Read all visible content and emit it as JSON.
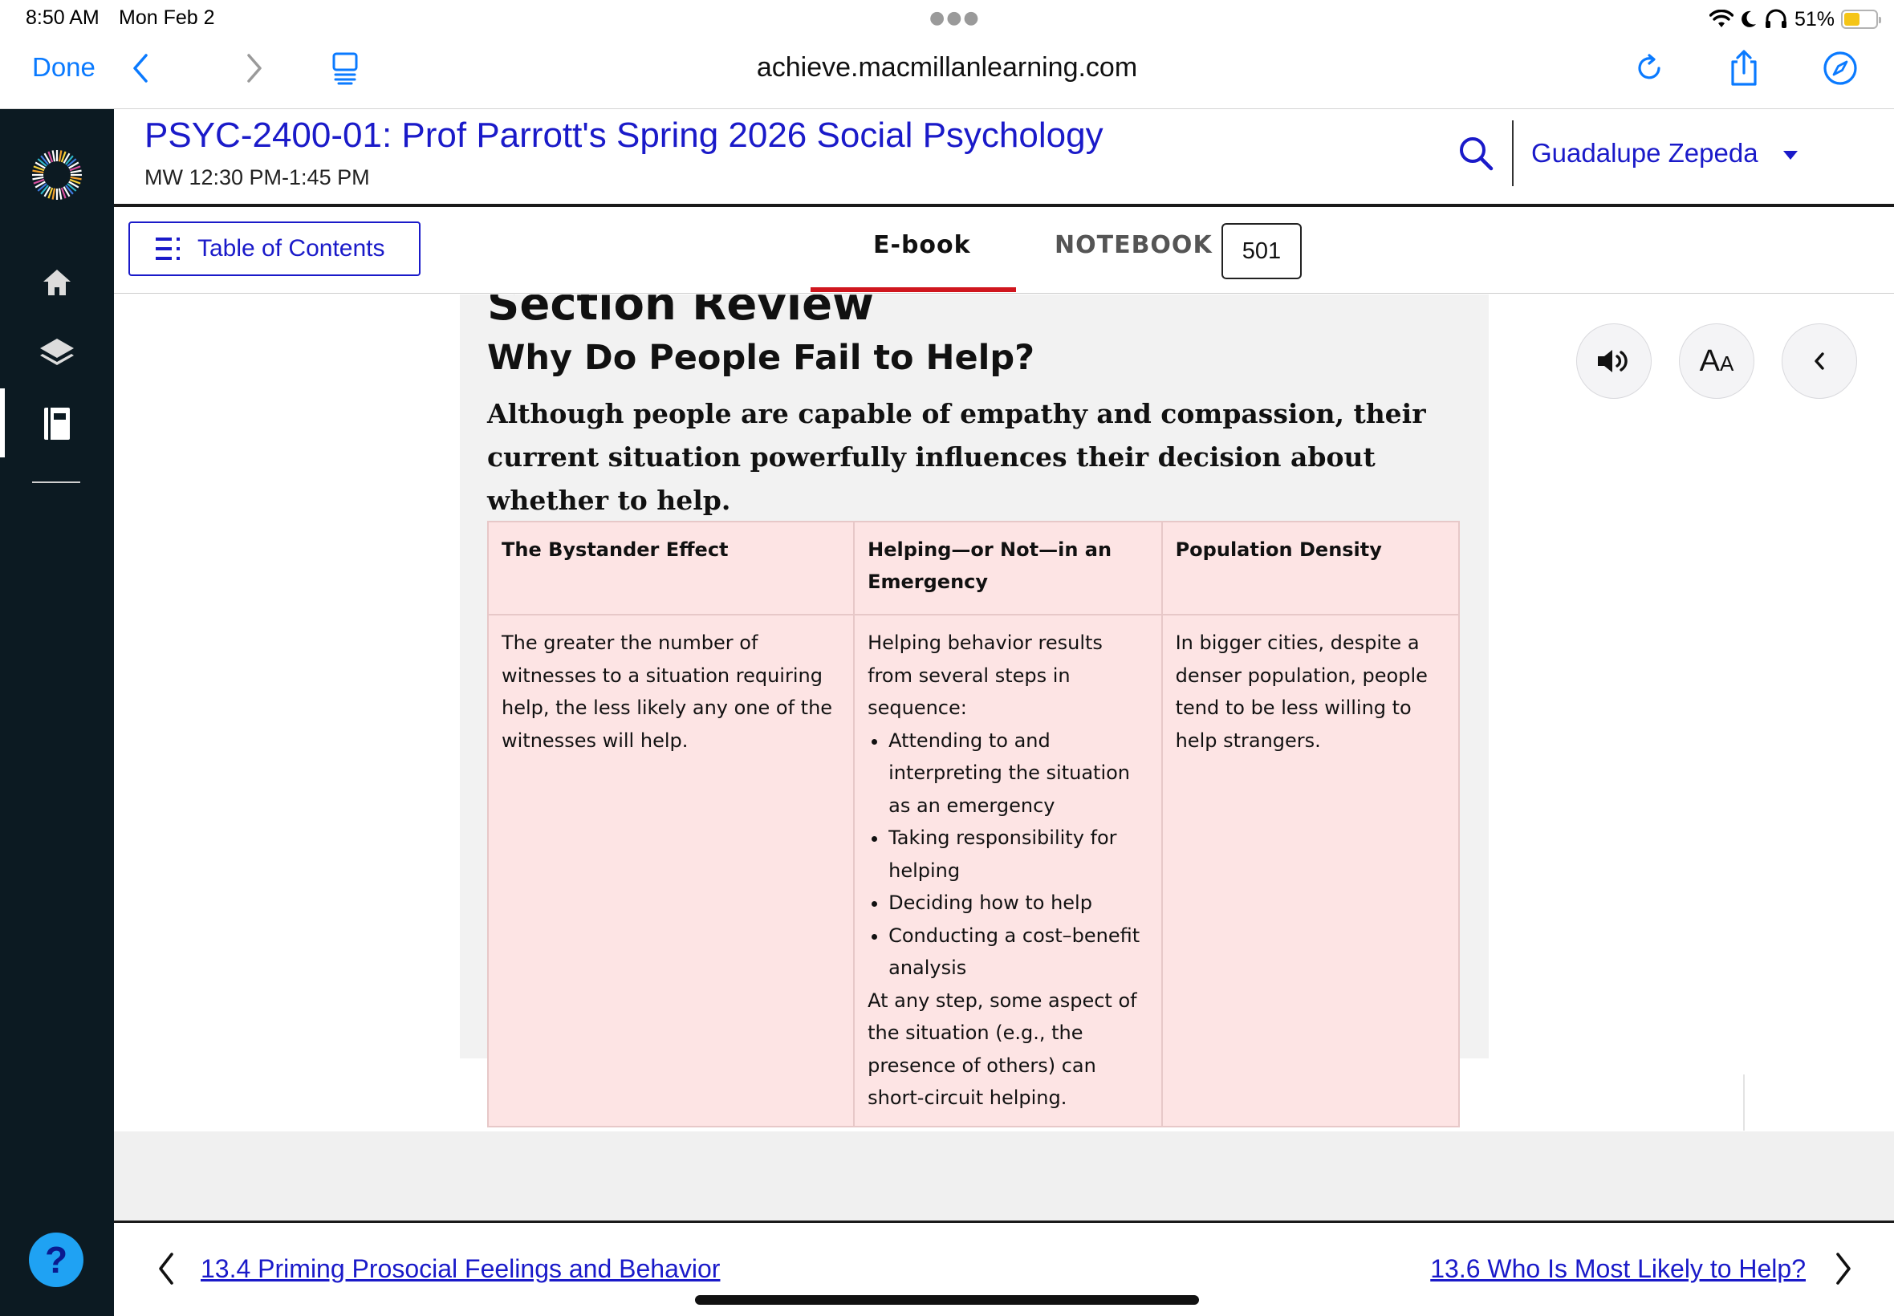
{
  "status_bar": {
    "time": "8:50 AM",
    "date": "Mon Feb 2",
    "battery": "51%",
    "battery_level": 0.51,
    "battery_color": "#f5c516",
    "icons": [
      "wifi-icon",
      "moon-icon",
      "headphones-icon",
      "battery-icon"
    ]
  },
  "browser": {
    "done_label": "Done",
    "url": "achieve.macmillanlearning.com",
    "accent": "#0a7aff",
    "icons": [
      "back-icon",
      "forward-icon",
      "tab-overview-icon",
      "reload-icon",
      "share-icon",
      "compass-icon"
    ]
  },
  "rail": {
    "background": "#0c1a22",
    "icons": [
      "logo-icon",
      "home-icon",
      "layers-icon",
      "notebook-icon"
    ],
    "help_label": "?"
  },
  "course": {
    "title": "PSYC-2400-01: Prof Parrott's Spring 2026 Social Psychology",
    "schedule": "MW 12:30 PM-1:45 PM",
    "user_name": "Guadalupe Zepeda",
    "brand_color": "#1a1ac9"
  },
  "tabs": {
    "toc_label": "Table of Contents",
    "ebook_label": "E-book",
    "notebook_label": "NOTEBOOK",
    "page_number": "501",
    "active_tab": "E-book",
    "active_color": "#d0161e"
  },
  "section": {
    "heading": "Section Review",
    "subheading": "Why Do People Fail to Help?",
    "summary": "Although people are capable of empathy and compassion, their current situation powerfully influences their decision about whether to help.",
    "table": {
      "headers": [
        "The Bystander Effect",
        "Helping—or Not—in an Emergency",
        "Population Density"
      ],
      "col1": "The greater the number of witnesses to a situation requiring help, the less likely any one of the witnesses will help.",
      "col2_intro": "Helping behavior results from several steps in sequence:",
      "col2_steps": [
        "Attending to and interpreting the situation as an emergency",
        "Taking responsibility for helping",
        "Deciding how to help",
        "Conducting a cost–benefit analysis"
      ],
      "col2_outro": "At any step, some aspect of the situation (e.g., the presence of others) can short-circuit helping.",
      "col3": "In bigger cities, despite a denser population, people tend to be less willing to help strangers.",
      "background": "#fde4e4"
    }
  },
  "tools": {
    "audio_icon": "speaker-icon",
    "text_size_label": "AA",
    "collapse_icon": "chevron-left-icon"
  },
  "bottom_nav": {
    "prev_label": "13.4 Priming Prosocial Feelings and Behavior",
    "next_label": "13.6 Who Is Most Likely to Help?"
  }
}
